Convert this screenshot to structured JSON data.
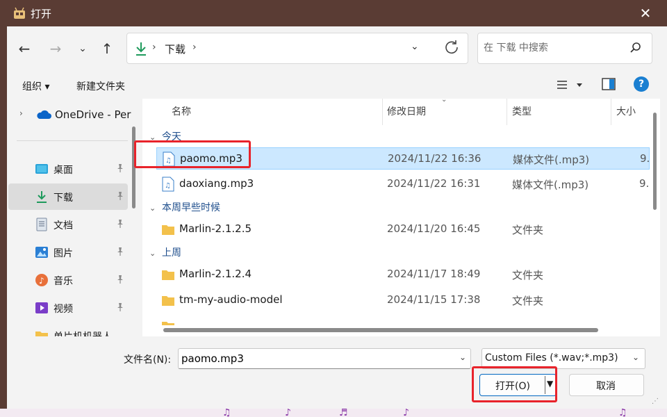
{
  "window": {
    "title": "打开",
    "close_glyph": "✕"
  },
  "address": {
    "separator": "›",
    "crumb": "下载",
    "dropdown_glyph": "⌄"
  },
  "search": {
    "placeholder": "在 下载 中搜索"
  },
  "toolbar": {
    "organize": "组织 ▾",
    "new_folder": "新建文件夹",
    "help": "?"
  },
  "nav": {
    "onedrive": "OneDrive - Per",
    "items": [
      {
        "label": "桌面",
        "icon": "desktop-icon"
      },
      {
        "label": "下载",
        "icon": "download-icon",
        "selected": true
      },
      {
        "label": "文档",
        "icon": "documents-icon"
      },
      {
        "label": "图片",
        "icon": "pictures-icon"
      },
      {
        "label": "音乐",
        "icon": "music-icon"
      },
      {
        "label": "视频",
        "icon": "videos-icon"
      },
      {
        "label": "单片机机器人",
        "icon": "folder-icon"
      }
    ]
  },
  "columns": {
    "name": "名称",
    "modified": "修改日期",
    "type": "类型",
    "size": "大小"
  },
  "groups": {
    "today": "今天",
    "earlier_week": "本周早些时候",
    "last_week": "上周"
  },
  "files": [
    {
      "name": "paomo.mp3",
      "date": "2024/11/22 16:36",
      "type": "媒体文件(.mp3)",
      "size": "9.",
      "kind": "audio",
      "selected": true
    },
    {
      "name": "daoxiang.mp3",
      "date": "2024/11/22 16:31",
      "type": "媒体文件(.mp3)",
      "size": "9.",
      "kind": "audio"
    },
    {
      "name": "Marlin-2.1.2.5",
      "date": "2024/11/20 16:45",
      "type": "文件夹",
      "size": "",
      "kind": "folder"
    },
    {
      "name": "Marlin-2.1.2.4",
      "date": "2024/11/17 18:49",
      "type": "文件夹",
      "size": "",
      "kind": "folder"
    },
    {
      "name": "tm-my-audio-model",
      "date": "2024/11/15 17:38",
      "type": "文件夹",
      "size": "",
      "kind": "folder"
    }
  ],
  "bottom": {
    "filename_label": "文件名(N):",
    "filename_value": "paomo.mp3",
    "filter": "Custom Files (*.wav;*.mp3)",
    "open": "打开(O)",
    "cancel": "取消"
  },
  "colors": {
    "titlebar": "#5a3c34",
    "selection": "#cce8ff",
    "highlight": "#e8232b",
    "accent": "#0067c0"
  }
}
